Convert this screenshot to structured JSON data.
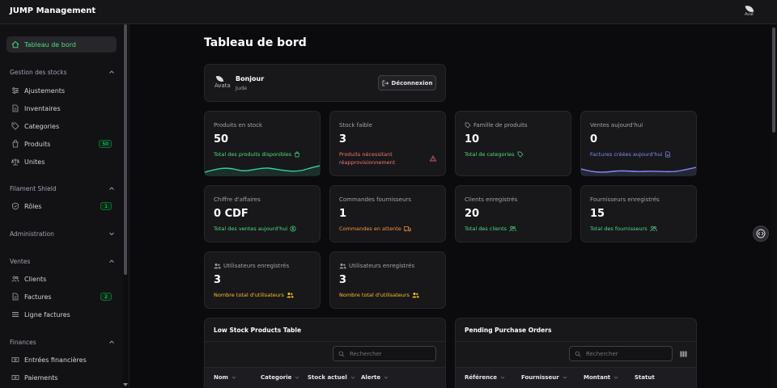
{
  "app": {
    "title": "JUMP Management",
    "avatar_alt": "Avat"
  },
  "sidebar": {
    "items": {
      "dashboard": "Tableau de bord",
      "adjustments": "Ajustements",
      "inventories": "Inventaires",
      "categories": "Categories",
      "products": "Produits",
      "units": "Unites",
      "roles": "Rôles",
      "clients": "Clients",
      "invoices": "Factures",
      "invoice_lines": "Ligne factures",
      "financial_entries": "Entrées financières",
      "payments": "Paiements"
    },
    "groups": {
      "stock": "Gestion des stocks",
      "shield": "Filament Shield",
      "admin": "Administration",
      "sales": "Ventes",
      "finance": "Finances"
    },
    "badges": {
      "products": "50",
      "roles": "1",
      "invoices": "2"
    }
  },
  "page": {
    "title": "Tableau de bord"
  },
  "welcome": {
    "avatar_alt": "Avata",
    "greeting": "Bonjour",
    "user": "Jude",
    "logout_label": "Déconnexion"
  },
  "stats": [
    {
      "label": "Produits en stock",
      "value": "50",
      "desc": "Total des produits disponibles",
      "color": "#4ade80",
      "icon": "shopping-bag-icon"
    },
    {
      "label": "Stock faible",
      "value": "3",
      "desc": "Produits nécessitant réapprovisionnement",
      "color": "#f87171",
      "icon": "warning-icon"
    },
    {
      "label": "Famille de produits",
      "value": "10",
      "desc": "Total de categories",
      "color": "#4ade80",
      "icon": "tag-icon"
    },
    {
      "label": "Ventes aujourd'hui",
      "value": "0",
      "desc": "Factures créées aujourd'hui",
      "color": "#818cf8",
      "icon": "document-icon"
    },
    {
      "label": "Chiffre d'affaires",
      "value": "0 CDF",
      "desc": "Total des ventes aujourd'hui",
      "color": "#4ade80",
      "icon": "currency-icon"
    },
    {
      "label": "Commandes fournisseurs",
      "value": "1",
      "desc": "Commandes en attente",
      "color": "#fb923c",
      "icon": "truck-icon"
    },
    {
      "label": "Clients enregistrés",
      "value": "20",
      "desc": "Total des clients",
      "color": "#4ade80",
      "icon": "users-icon"
    },
    {
      "label": "Fournisseurs enregistrés",
      "value": "15",
      "desc": "Total des fournisseurs",
      "color": "#4ade80",
      "icon": "users-icon"
    },
    {
      "label": "Utilisateurs enregistrés",
      "value": "3",
      "desc": "Nombre total d'utilisateurs",
      "color": "#fbbf24",
      "icon": "users-icon"
    },
    {
      "label": "Utilisateurs enregistrés",
      "value": "3",
      "desc": "Nombre total d'utilisateurs",
      "color": "#fbbf24",
      "icon": "users-icon"
    }
  ],
  "tables": {
    "low_stock": {
      "title": "Low Stock Products Table",
      "search_placeholder": "Rechercher",
      "columns": [
        "Nom",
        "Categorie",
        "Stock actuel",
        "Alerte"
      ]
    },
    "pending_orders": {
      "title": "Pending Purchase Orders",
      "search_placeholder": "Rechercher",
      "columns": [
        "Référence",
        "Fournisseur",
        "Montant",
        "Statut"
      ]
    }
  }
}
